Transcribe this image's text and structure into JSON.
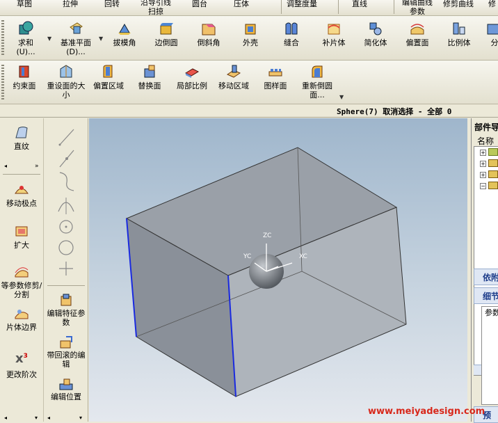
{
  "toolbar_top": {
    "labels": [
      "草图",
      "拉伸",
      "回转",
      "沿导引线扫掠",
      "圆台",
      "压体",
      "调整度量",
      "直线",
      "编辑曲线参数",
      "修剪曲线",
      "修"
    ]
  },
  "toolbar_row1": {
    "items": [
      {
        "label": "求和",
        "sub": "(U)...",
        "icon": "unite-icon"
      },
      {
        "label": "基准平面",
        "sub": "(D)...",
        "icon": "datum-plane-icon"
      },
      {
        "label": "拔模角",
        "icon": "draft-icon"
      },
      {
        "label": "边倒圆",
        "icon": "edge-blend-icon"
      },
      {
        "label": "倒斜角",
        "icon": "chamfer-icon"
      },
      {
        "label": "外壳",
        "icon": "shell-icon"
      },
      {
        "label": "缝合",
        "icon": "sew-icon"
      },
      {
        "label": "补片体",
        "icon": "patch-icon"
      },
      {
        "label": "简化体",
        "icon": "simplify-icon"
      },
      {
        "label": "偏置面",
        "icon": "offset-face-icon"
      },
      {
        "label": "比例体",
        "icon": "scale-body-icon"
      },
      {
        "label": "分",
        "icon": "split-icon"
      }
    ]
  },
  "toolbar_row2": {
    "items": [
      {
        "label": "约束面",
        "icon": "constrain-face-icon"
      },
      {
        "label": "重设面的大小",
        "icon": "resize-face-icon"
      },
      {
        "label": "偏置区域",
        "icon": "offset-region-icon"
      },
      {
        "label": "替换面",
        "icon": "replace-face-icon"
      },
      {
        "label": "局部比例",
        "icon": "local-scale-icon"
      },
      {
        "label": "移动区域",
        "icon": "move-region-icon"
      },
      {
        "label": "图样面",
        "icon": "pattern-face-icon"
      },
      {
        "label": "重新倒圆面...",
        "icon": "reblend-face-icon"
      }
    ]
  },
  "status": {
    "text": "Sphere(7) 取消选择 - 全部 0"
  },
  "left_panel": {
    "items": [
      {
        "label": "直纹",
        "icon": "ruled-icon"
      },
      {
        "label": "移动极点",
        "icon": "move-pole-icon"
      },
      {
        "label": "扩大",
        "icon": "enlarge-icon"
      },
      {
        "label": "等参数修剪/分割",
        "icon": "iso-trim-icon"
      },
      {
        "label": "片体边界",
        "icon": "sheet-boundary-icon"
      },
      {
        "label": "更改阶次",
        "icon": "change-degree-icon"
      }
    ]
  },
  "mid_panel": {
    "items": [
      {
        "label": "编辑特征参数",
        "icon": "edit-feature-icon"
      },
      {
        "label": "带回滚的编辑",
        "icon": "edit-rollback-icon"
      },
      {
        "label": "编辑位置",
        "icon": "edit-position-icon"
      }
    ]
  },
  "viewport": {
    "axis_zc": "ZC",
    "axis_yc": "YC",
    "axis_xc": "XC"
  },
  "part_navigator": {
    "title": "部件导",
    "column": "名称",
    "dependency": "依附",
    "details": "细节",
    "params": "参数",
    "preview": "预"
  },
  "watermark": "www.meiyadesign.com"
}
